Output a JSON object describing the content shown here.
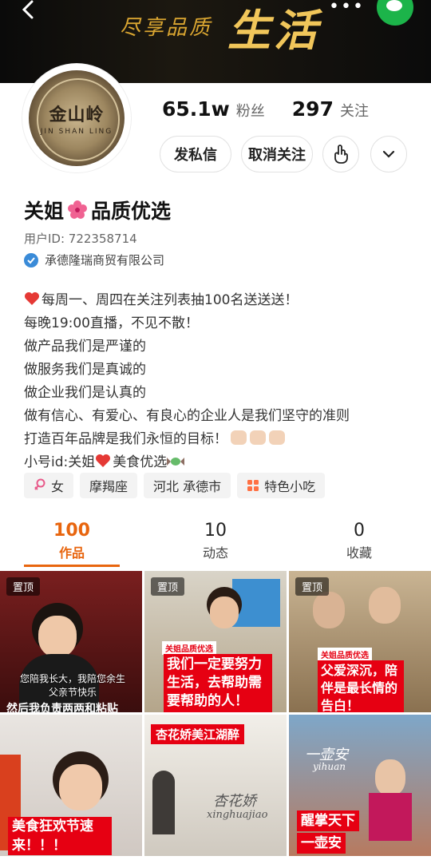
{
  "header": {
    "banner_slogan": "尽享品质",
    "banner_big": "生活",
    "more_label": "•••"
  },
  "profile": {
    "avatar_text": "金山岭",
    "avatar_sub": "JIN SHAN LING",
    "followers_value": "65.1w",
    "followers_label": "粉丝",
    "following_value": "297",
    "following_label": "关注",
    "message_btn": "发私信",
    "unfollow_btn": "取消关注",
    "name_prefix": "关姐",
    "name_suffix": "品质优选",
    "user_id": "用户ID: 722358714",
    "company": "承德隆瑞商贸有限公司"
  },
  "bio": {
    "line1": "每周一、周四在关注列表抽100名送送送！",
    "line2": "每晚19:00直播，不见不散！",
    "line3": "做产品我们是严谨的",
    "line4": "做服务我们是真诚的",
    "line5": "做企业我们是认真的",
    "line6": "做有信心、有爱心、有良心的企业人是我们坚守的准则",
    "line7": "打造百年品牌是我们永恒的目标！",
    "line8_prefix": "小号id:关姐",
    "line8_suffix": "美食优选"
  },
  "tags": [
    "女",
    "摩羯座",
    "河北 承德市",
    "特色小吃"
  ],
  "tabs": [
    {
      "count": "100",
      "label": "作品"
    },
    {
      "count": "10",
      "label": "动态"
    },
    {
      "count": "0",
      "label": "收藏"
    }
  ],
  "videos": {
    "pin_label": "置顶",
    "v1_caption": "您陪我长大，我陪您余生",
    "v1_caption2": "父亲节快乐",
    "v1_bottom": "然后我负责两两和粘贴",
    "v2_brand": "关姐品质优选",
    "v2_caption": "我们一定要努力生活，去帮助需要帮助的人！",
    "v3_brand": "关姐品质优选",
    "v3_caption": "父爱深沉，陪伴是最长情的告白！",
    "v4_caption": "美食狂欢节速来！！！",
    "v5_title": "杏花娇美江湖醉",
    "v5_script": "杏花娇",
    "v5_sub": "xinghuajiao",
    "v6_title": "一壶安",
    "v6_sub": "yihuan",
    "v6_caption1": "醒掌天下",
    "v6_caption2": "一壶安"
  },
  "colors": {
    "accent": "#e8650e",
    "caption_red": "#e60012",
    "verify_blue": "#3a8bd8"
  }
}
